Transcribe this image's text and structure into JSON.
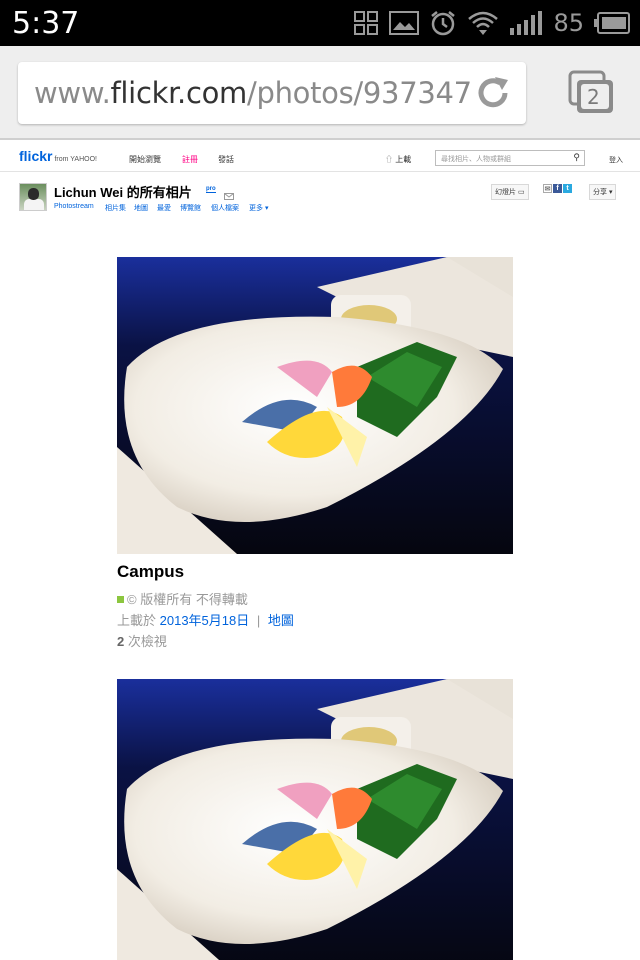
{
  "status_bar": {
    "time": "5:37",
    "battery_level": "85",
    "icons": [
      "grid-icon",
      "image-icon",
      "alarm-icon",
      "wifi-icon",
      "signal-icon",
      "battery-icon"
    ]
  },
  "browser": {
    "url_prefix": "www.",
    "url_domain": "flickr.com",
    "url_path": "/photos/937347",
    "tab_count": "2"
  },
  "flickr_header": {
    "logo": "flickr",
    "logo_suffix": "from YAHOO!",
    "nav": [
      "開始瀏覽",
      "註冊",
      "發話"
    ],
    "upload": "上載",
    "search_placeholder": "尋找相片、人物或群組",
    "signin": "登入"
  },
  "owner": {
    "name": "Lichun Wei 的所有相片",
    "pro": "pro",
    "subnav": [
      "Photostream",
      "相片集",
      "地圖",
      "最愛",
      "博覽館",
      "個人檔案",
      "更多 ▾"
    ],
    "slideshow": "幻燈片",
    "share": "分享 ▾"
  },
  "photo1": {
    "title": "Campus",
    "license": "版權所有 不得轉載",
    "uploaded_prefix": "上載於",
    "uploaded_date": "2013年5月18日",
    "separator": "|",
    "map_link": "地圖",
    "views_count": "2",
    "views_label": "次檢視"
  },
  "colors": {
    "flickr_blue": "#0063dc",
    "flickr_pink": "#ff0084",
    "meta_gray": "#999999"
  }
}
